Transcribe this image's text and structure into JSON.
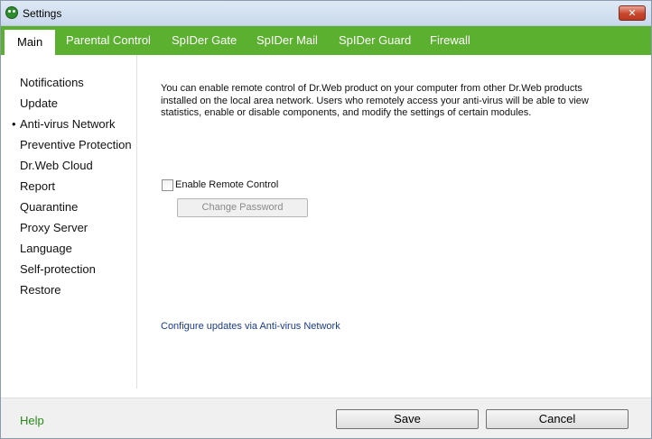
{
  "window": {
    "title": "Settings",
    "close_label": "✕"
  },
  "tabs": [
    {
      "label": "Main"
    },
    {
      "label": "Parental Control"
    },
    {
      "label": "SpIDer Gate"
    },
    {
      "label": "SpIDer Mail"
    },
    {
      "label": "SpIDer Guard"
    },
    {
      "label": "Firewall"
    }
  ],
  "sidebar": {
    "bullet": "•",
    "items": [
      {
        "label": "Notifications"
      },
      {
        "label": "Update"
      },
      {
        "label": "Anti-virus Network"
      },
      {
        "label": "Preventive Protection"
      },
      {
        "label": "Dr.Web Cloud"
      },
      {
        "label": "Report"
      },
      {
        "label": "Quarantine"
      },
      {
        "label": "Proxy Server"
      },
      {
        "label": "Language"
      },
      {
        "label": "Self-protection"
      },
      {
        "label": "Restore"
      }
    ]
  },
  "content": {
    "description": "You can enable remote control of Dr.Web product on your computer from other Dr.Web products installed on the local area network. Users who remotely access your anti-virus will be able to view statistics, enable or disable components, and modify the settings of certain modules.",
    "enable_remote_label": "Enable Remote Control",
    "change_password_label": "Change Password",
    "configure_link": "Configure updates via Anti-virus Network"
  },
  "footer": {
    "help_label": "Help",
    "save_label": "Save",
    "cancel_label": "Cancel"
  },
  "colors": {
    "tab_bar": "#5cb030",
    "help_link": "#2a8a1a",
    "content_link": "#1a3a8c"
  }
}
